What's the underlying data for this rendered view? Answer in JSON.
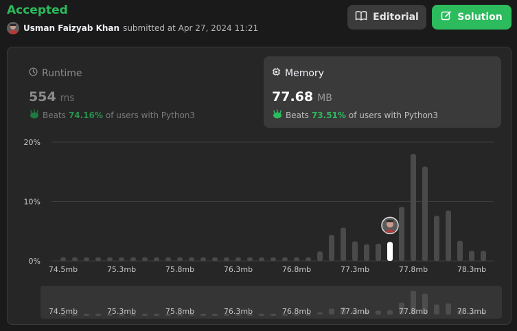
{
  "status": "Accepted",
  "submission": {
    "user": "Usman Faizyab Khan",
    "meta": "submitted at Apr 27, 2024 11:21"
  },
  "buttons": {
    "editorial": "Editorial",
    "solution": "Solution"
  },
  "runtime": {
    "title": "Runtime",
    "value": "554",
    "unit": "ms",
    "beats_label": "Beats",
    "beats_pct": "74.16%",
    "beats_suffix": "of users with Python3"
  },
  "memory": {
    "title": "Memory",
    "value": "77.68",
    "unit": "MB",
    "beats_label": "Beats",
    "beats_pct": "73.51%",
    "beats_suffix": "of users with Python3"
  },
  "colors": {
    "accent": "#2cbb5d",
    "bar": "#4a4a4a",
    "bar_selected": "#ffffff"
  },
  "icons": {
    "avatar": "user-avatar",
    "editorial": "book-icon",
    "solution": "edit-icon",
    "runtime": "clock-icon",
    "memory": "chip-icon",
    "beats": "clap-icon"
  },
  "chart_data": {
    "type": "bar",
    "y_ticks": [
      "20%",
      "10%",
      "0%"
    ],
    "ylim": [
      0,
      20
    ],
    "x_tick_labels": [
      "74.5mb",
      "75.3mb",
      "75.8mb",
      "76.3mb",
      "76.8mb",
      "77.3mb",
      "77.8mb",
      "78.3mb"
    ],
    "values": [
      0.6,
      0.6,
      0.6,
      0.6,
      0.6,
      0.6,
      0.6,
      0.6,
      0.6,
      0.6,
      0.6,
      0.6,
      0.6,
      0.6,
      0.6,
      0.6,
      0.6,
      0.6,
      0.6,
      0.6,
      0.6,
      0.6,
      1.6,
      4.4,
      5.6,
      3.3,
      2.8,
      2.9,
      3.2,
      9.1,
      18.0,
      15.9,
      7.6,
      8.5,
      3.4,
      1.7,
      1.7
    ],
    "selected_index": 28,
    "grid": true
  }
}
